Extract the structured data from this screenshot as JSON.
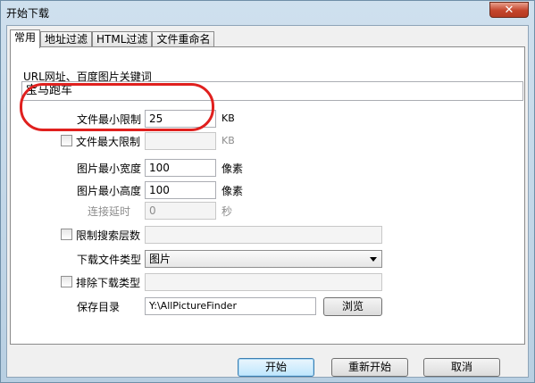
{
  "window": {
    "title": "开始下载",
    "close_glyph": "✕"
  },
  "tabs": [
    {
      "label": "常用",
      "active": true
    },
    {
      "label": "地址过滤",
      "active": false
    },
    {
      "label": "HTML过滤",
      "active": false
    },
    {
      "label": "文件重命名",
      "active": false
    }
  ],
  "form": {
    "url_label": "URL网址、百度图片关键词",
    "url_value": "宝马跑车",
    "min_size_label": "文件最小限制",
    "min_size_value": "25",
    "min_size_unit": "KB",
    "max_size_label": "文件最大限制",
    "max_size_value": "",
    "max_size_unit": "KB",
    "min_width_label": "图片最小宽度",
    "min_width_value": "100",
    "min_width_unit": "像素",
    "min_height_label": "图片最小高度",
    "min_height_value": "100",
    "min_height_unit": "像素",
    "delay_label": "连接延时",
    "delay_value": "0",
    "delay_unit": "秒",
    "depth_label": "限制搜索层数",
    "depth_value": "",
    "type_label": "下载文件类型",
    "type_value": "图片",
    "exclude_label": "排除下载类型",
    "exclude_value": "",
    "dir_label": "保存目录",
    "dir_value": "Y:\\AllPictureFinder",
    "browse_label": "浏览"
  },
  "buttons": {
    "start": "开始",
    "restart": "重新开始",
    "cancel": "取消"
  },
  "colors": {
    "annotation": "#e0201e",
    "default_button": "#3c7fb1"
  }
}
